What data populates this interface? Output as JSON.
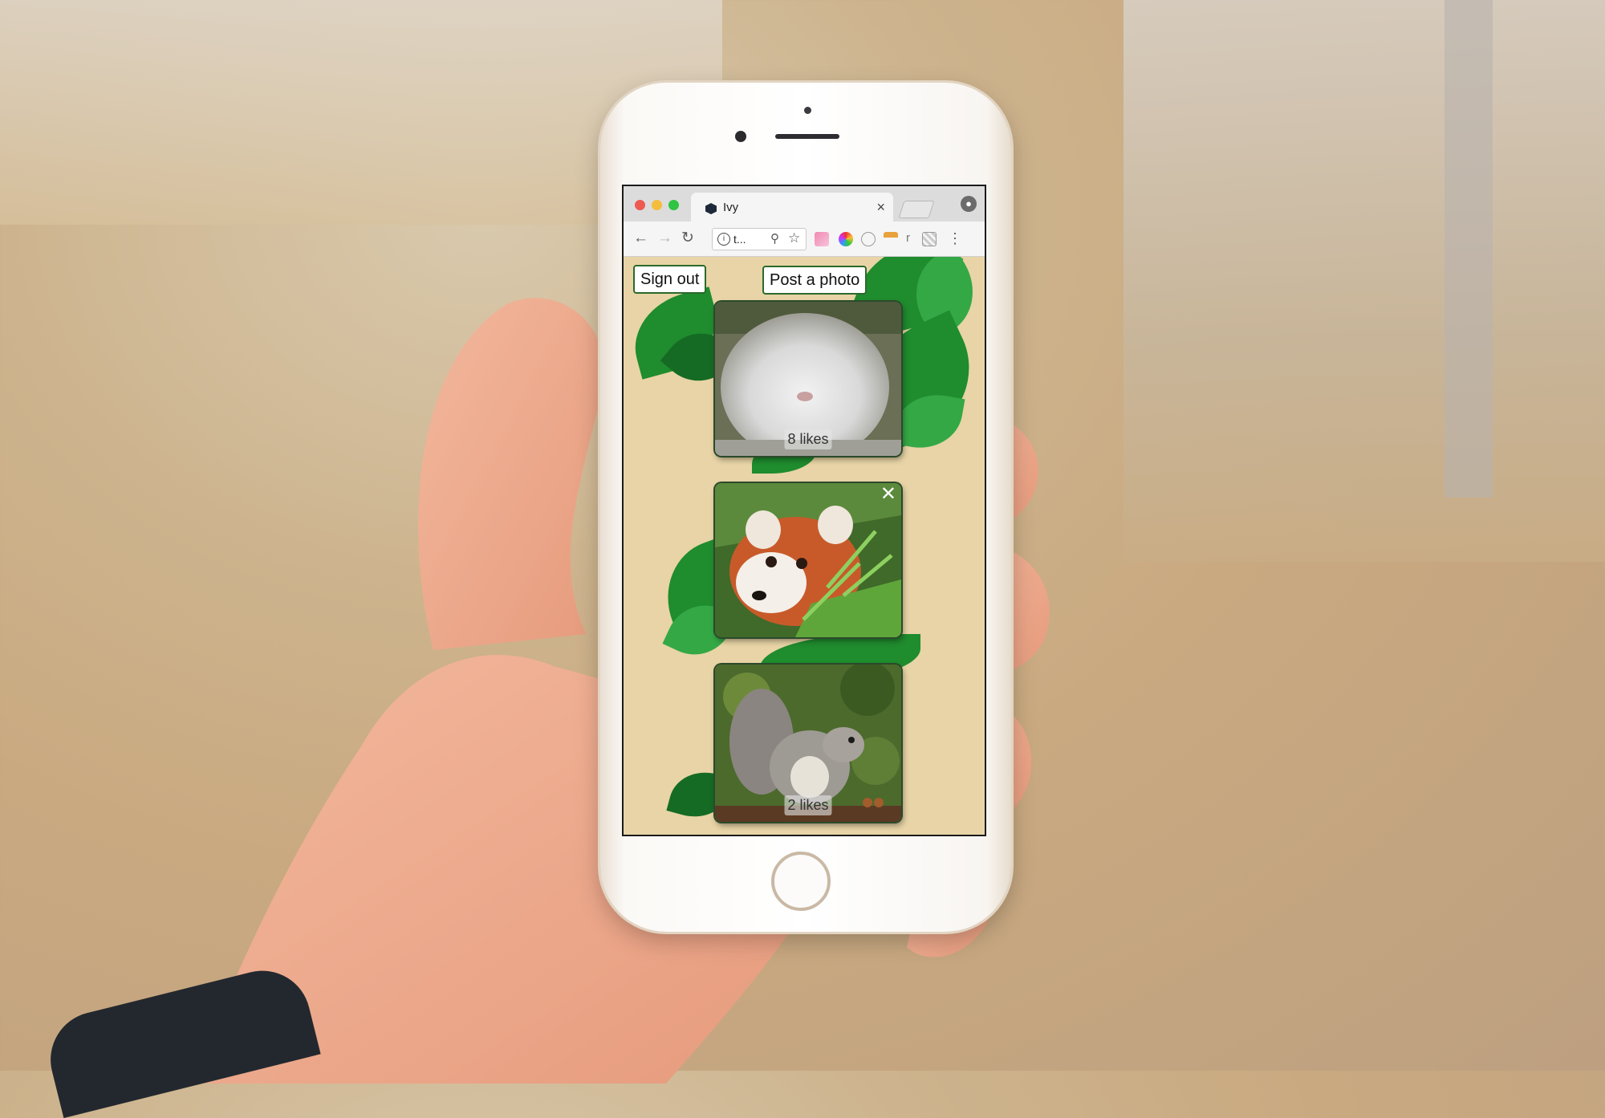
{
  "browser": {
    "tab_title": "Ivy",
    "tab_close": "×",
    "address_text": "t...",
    "profile_icon": "person-icon",
    "more_menu": "⋮",
    "ext_letter": "r"
  },
  "app": {
    "sign_out_label": "Sign out",
    "post_photo_label": "Post a photo",
    "colors": {
      "background": "#e8d4a6",
      "leaf": "#1f8c2e",
      "button_border": "#2b6a2b"
    }
  },
  "feed": [
    {
      "subject": "fluffy white rabbit",
      "likes": "8 likes",
      "show_close": false
    },
    {
      "subject": "red panda",
      "likes": "",
      "show_close": true
    },
    {
      "subject": "grey squirrel",
      "likes": "2 likes",
      "show_close": false
    }
  ],
  "close_glyph": "✕"
}
